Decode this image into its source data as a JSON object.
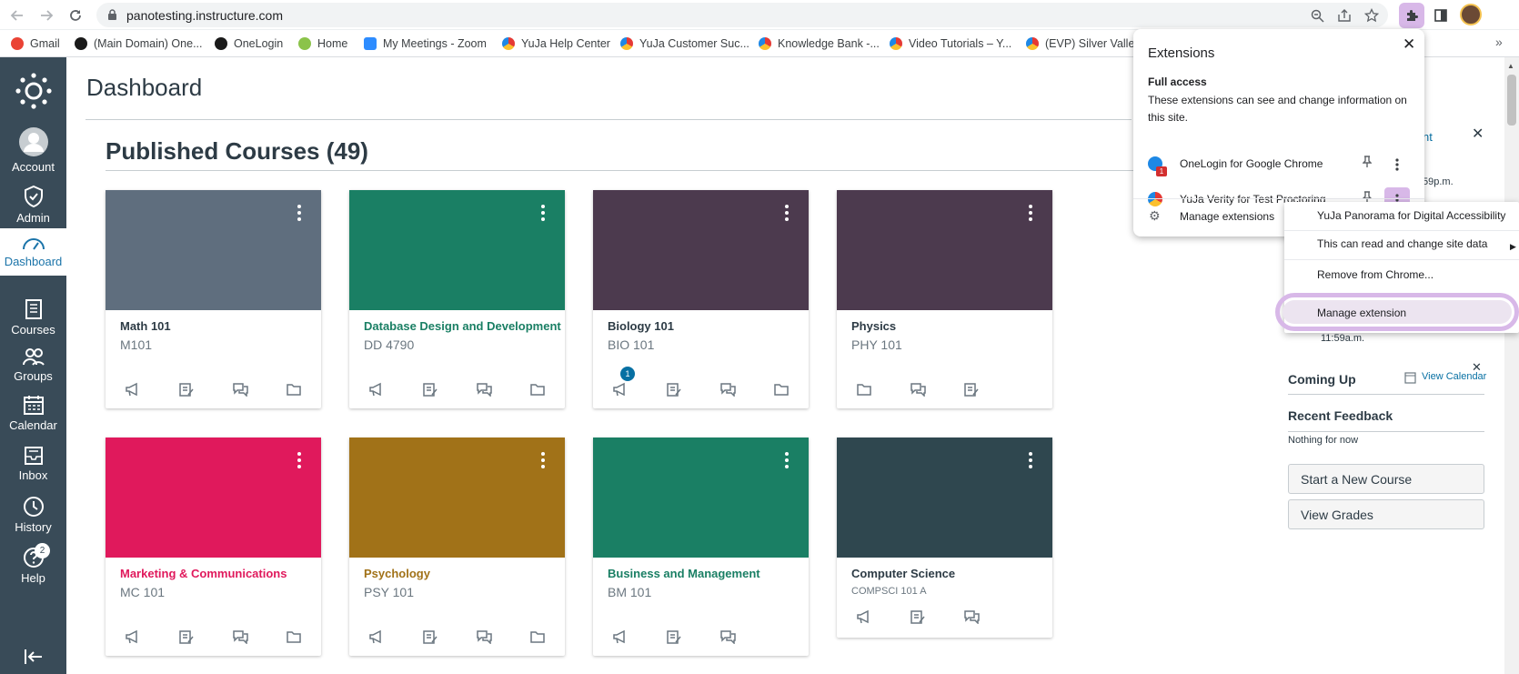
{
  "browser": {
    "url": "panotesting.instructure.com",
    "bookmarks": [
      {
        "label": "Gmail",
        "color": "#ea4335"
      },
      {
        "label": "(Main Domain) One...",
        "color": "#1a1a1a"
      },
      {
        "label": "OneLogin",
        "color": "#1a1a1a"
      },
      {
        "label": "Home",
        "color": "#8bc34a"
      },
      {
        "label": "My Meetings - Zoom",
        "color": "#2d8cff"
      },
      {
        "label": "YuJa Help Center",
        "color": "#e53935"
      },
      {
        "label": "YuJa Customer Suc...",
        "color": "#e53935"
      },
      {
        "label": "Knowledge Bank -...",
        "color": "#e53935"
      },
      {
        "label": "Video Tutorials – Y...",
        "color": "#e53935"
      },
      {
        "label": "(EVP) Silver Valley",
        "color": "#e53935"
      }
    ],
    "more_bookmarks": "»"
  },
  "global_nav": {
    "items": [
      {
        "label": "Account",
        "icon": "account-icon"
      },
      {
        "label": "Admin",
        "icon": "admin-icon"
      },
      {
        "label": "Dashboard",
        "icon": "dashboard-icon"
      },
      {
        "label": "Courses",
        "icon": "courses-icon"
      },
      {
        "label": "Groups",
        "icon": "groups-icon"
      },
      {
        "label": "Calendar",
        "icon": "calendar-icon"
      },
      {
        "label": "Inbox",
        "icon": "inbox-icon"
      },
      {
        "label": "History",
        "icon": "history-icon"
      },
      {
        "label": "Help",
        "icon": "help-icon"
      }
    ],
    "help_badge": "2"
  },
  "dashboard": {
    "title": "Dashboard",
    "section_title": "Published Courses (49)",
    "courses": [
      {
        "name": "Math 101",
        "code": "M101",
        "color": "#5f6e7e",
        "name_color": "#2d3b45"
      },
      {
        "name": "Database Design and Development",
        "code": "DD 4790",
        "color": "#1a7f64",
        "name_color": "#1a7f64"
      },
      {
        "name": "Biology 101",
        "code": "BIO 101",
        "color": "#4c3a4e",
        "name_color": "#2d3b45",
        "unread": "1"
      },
      {
        "name": "Physics",
        "code": "PHY 101",
        "color": "#4c3a4e",
        "name_color": "#2d3b45"
      },
      {
        "name": "Marketing & Communications",
        "code": "MC 101",
        "color": "#e0195c",
        "name_color": "#e0195c"
      },
      {
        "name": "Psychology",
        "code": "PSY 101",
        "color": "#a17218",
        "name_color": "#a17218"
      },
      {
        "name": "Business and Management",
        "code": "BM 101",
        "color": "#1a7f64",
        "name_color": "#1a7f64"
      },
      {
        "name": "Computer Science",
        "code": "COMPSCI 101 A",
        "color": "#2f474f",
        "name_color": "#2d3b45"
      }
    ]
  },
  "sidebar": {
    "partial_link": "ment",
    "partial_time_1": "59p.m.",
    "partial_time_2": "11:59a.m.",
    "coming_up": "Coming Up",
    "view_calendar": "View Calendar",
    "recent_feedback": "Recent Feedback",
    "nothing_for_now": "Nothing for now",
    "start_course": "Start a New Course",
    "view_grades": "View Grades",
    "close": "✕"
  },
  "extensions_popup": {
    "title": "Extensions",
    "close": "✕",
    "section": "Full access",
    "description": "These extensions can see and change information on this site.",
    "items": [
      {
        "name": "OneLogin for Google Chrome",
        "badge": "1"
      },
      {
        "name": "YuJa Verity for Test Proctoring"
      }
    ],
    "manage": "Manage extensions"
  },
  "context_menu": {
    "items": [
      "YuJa Panorama for Digital Accessibility",
      "This can read and change site data",
      "Remove from Chrome...",
      "Manage extension"
    ]
  },
  "colors": {
    "canvas_nav": "#394b58",
    "highlight": "#d8b8e8",
    "link": "#0770a3"
  }
}
